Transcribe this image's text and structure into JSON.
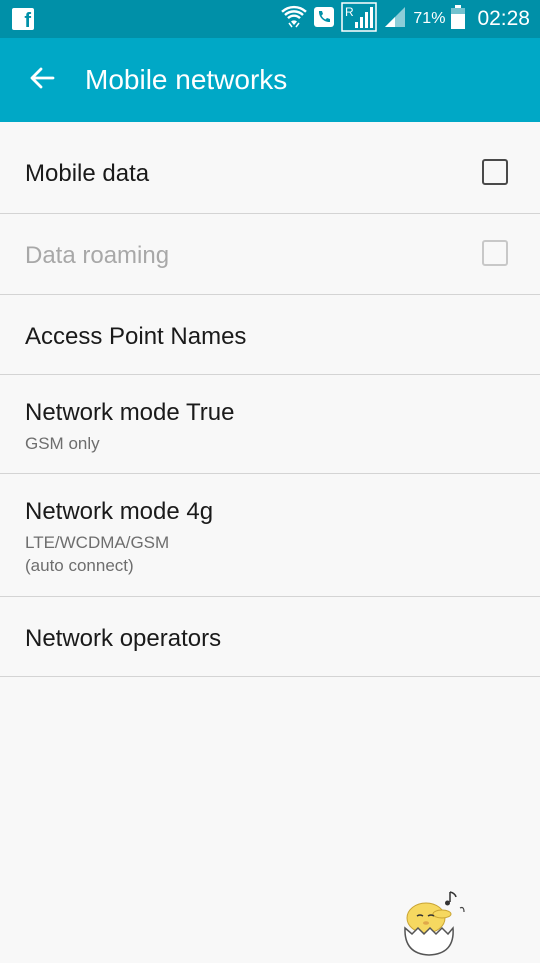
{
  "status_bar": {
    "app_icon": "facebook-icon",
    "icons": [
      "wifi-icon",
      "phone-call-icon",
      "roaming-signal-icon",
      "signal-icon",
      "battery-icon"
    ],
    "battery_percent": "71%",
    "time": "02:28"
  },
  "app_bar": {
    "back_icon": "arrow-left-icon",
    "title": "Mobile networks"
  },
  "settings": {
    "mobile_data": {
      "title": "Mobile data",
      "checked": false,
      "enabled": true
    },
    "data_roaming": {
      "title": "Data roaming",
      "checked": false,
      "enabled": false
    },
    "apn": {
      "title": "Access Point Names"
    },
    "network_mode_true": {
      "title": "Network mode True",
      "summary": "GSM only"
    },
    "network_mode_4g": {
      "title": "Network mode 4g",
      "summary_line1": "LTE/WCDMA/GSM",
      "summary_line2": "(auto connect)"
    },
    "network_operators": {
      "title": "Network operators"
    }
  },
  "colors": {
    "status_bar": "#0090a8",
    "app_bar": "#00a8c6",
    "background": "#f8f8f8",
    "divider": "#d4d4d4"
  },
  "decoration": {
    "mascot_icon": "egg-mascot-icon"
  }
}
